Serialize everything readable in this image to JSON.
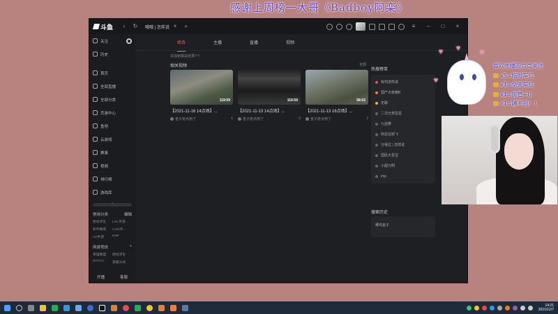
{
  "overlay": {
    "banner": "感谢上周榜一大哥《Badboy阿栾》",
    "perks": [
      {
        "text": "喜欢主播的点点关注",
        "icon": "none"
      },
      {
        "text": "x5=临时车位",
        "icon": "ticket-icon"
      },
      {
        "text": "x1=全天车位",
        "icon": "wand-icon"
      },
      {
        "text": "x1=房管+U",
        "icon": "boat-icon"
      },
      {
        "text": "x1=蹲不到！！",
        "icon": "rocket-icon"
      }
    ]
  },
  "titlebar": {
    "logo": "斗鱼",
    "search_tab": "哦哦 | 怎样说"
  },
  "sidebar": {
    "items": [
      {
        "label": "关注"
      },
      {
        "label": "历史"
      },
      {
        "label": "首页"
      },
      {
        "label": "全部直播"
      },
      {
        "label": "全部分类"
      },
      {
        "label": "页游中心"
      },
      {
        "label": "鱼吧"
      },
      {
        "label": "云游戏"
      },
      {
        "label": "赛事"
      },
      {
        "label": "视频"
      },
      {
        "label": "排行榜"
      },
      {
        "label": "游戏库"
      }
    ],
    "common_section": {
      "title": "常用分类",
      "action": "编辑"
    },
    "common_cats": [
      "绝地求生",
      "LOL手游",
      "和平精英",
      "COD手...",
      "CF手游",
      "DNF"
    ],
    "game_section": {
      "title": "网游竞技",
      "action": "+"
    },
    "game_cats": [
      "英雄联盟",
      "绝地求生",
      "DOTA2",
      "穿越火线"
    ],
    "footer": {
      "left": "开播",
      "right": "客服"
    }
  },
  "main": {
    "tabs": [
      "综合",
      "主播",
      "直播",
      "视频"
    ],
    "result_count": "共找到相关结果7个",
    "section_title": "相关视频",
    "more": "全部",
    "videos": [
      {
        "title": "【2021-11-16 14点场】...",
        "duration": "119:59",
        "author": "金子抢点用了",
        "count": "1"
      },
      {
        "title": "【2021-11-13 14点场】...",
        "duration": "119:59",
        "author": "金子抢点用了",
        "count": "2"
      },
      {
        "title": "【2021-11-13 16点场】...",
        "duration": "68:02",
        "author": "金子抢点用了",
        "count": "2"
      }
    ],
    "hot_title": "热搜榜单",
    "hot_items": [
      {
        "label": "有何怎样说",
        "color": "#e84d4d"
      },
      {
        "label": "国产大帐棚B",
        "color": "#f07b2c"
      },
      {
        "label": "无聊",
        "color": "#f0b429"
      },
      {
        "label": "二次元贺星星",
        "color": "#666666"
      },
      {
        "label": "七迷雾",
        "color": "#666666"
      },
      {
        "label": "阿龙在鲜飞",
        "color": "#666666"
      },
      {
        "label": "分得过 | 怎样说",
        "color": "#666666"
      },
      {
        "label": "国民大爱宝",
        "color": "#666666"
      },
      {
        "label": "小超元明",
        "color": "#666666"
      },
      {
        "label": "imp",
        "color": "#666666"
      }
    ],
    "history_title": "搜索历史",
    "history_item": "哪鸡金子"
  },
  "taskbar": {
    "time": "14:21",
    "date": "2021/12/7"
  }
}
